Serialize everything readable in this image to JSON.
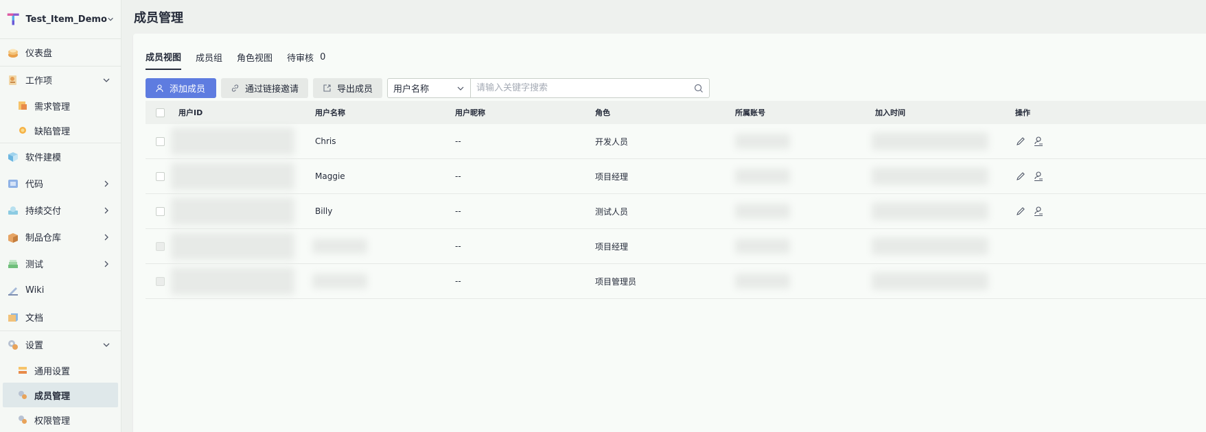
{
  "project": {
    "name": "Test_Item_Demo"
  },
  "sidebar": {
    "items": [
      {
        "label": "仪表盘"
      },
      {
        "label": "工作项"
      },
      {
        "label": "需求管理"
      },
      {
        "label": "缺陷管理"
      },
      {
        "label": "软件建模"
      },
      {
        "label": "代码"
      },
      {
        "label": "持续交付"
      },
      {
        "label": "制品仓库"
      },
      {
        "label": "测试"
      },
      {
        "label": "Wiki"
      },
      {
        "label": "文档"
      },
      {
        "label": "设置"
      },
      {
        "label": "通用设置"
      },
      {
        "label": "成员管理"
      },
      {
        "label": "权限管理"
      }
    ]
  },
  "page": {
    "title": "成员管理"
  },
  "tabs": [
    {
      "label": "成员视图"
    },
    {
      "label": "成员组"
    },
    {
      "label": "角色视图"
    },
    {
      "label": "待审核",
      "count": "0"
    }
  ],
  "toolbar": {
    "add_member": "添加成员",
    "invite_link": "通过链接邀请",
    "export": "导出成员",
    "filter_selected": "用户名称",
    "search_placeholder": "请输入关键字搜索"
  },
  "table": {
    "headers": [
      "用户ID",
      "用户名称",
      "用户昵称",
      "角色",
      "所属账号",
      "加入时间",
      "操作"
    ],
    "rows": [
      {
        "name": "Chris",
        "nickname": "--",
        "role": "开发人员"
      },
      {
        "name": "Maggie",
        "nickname": "--",
        "role": "项目经理"
      },
      {
        "name": "Billy",
        "nickname": "--",
        "role": "测试人员"
      },
      {
        "name": "",
        "nickname": "--",
        "role": "项目经理"
      },
      {
        "name": "",
        "nickname": "--",
        "role": "项目管理员"
      }
    ]
  },
  "colors": {
    "accent": "#5e7ce0",
    "active_nav": "#dfe8ea",
    "page_bg": "#eef1ee"
  }
}
